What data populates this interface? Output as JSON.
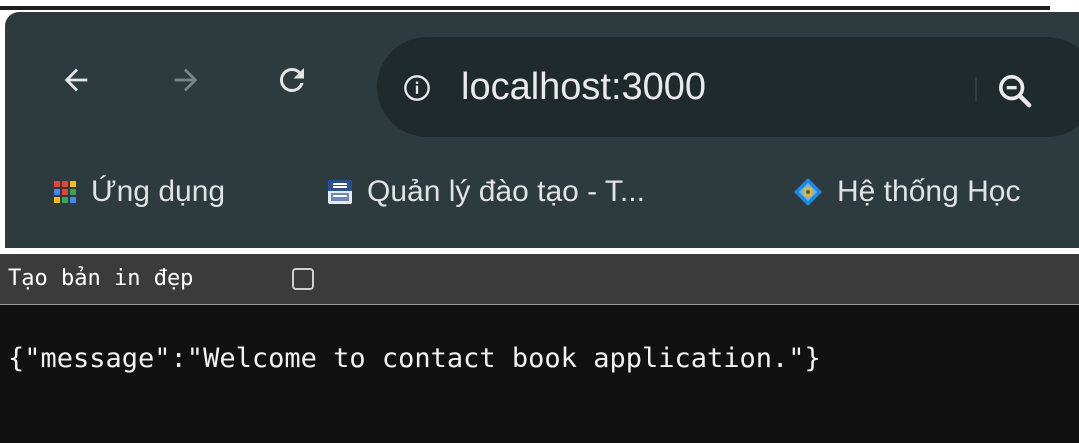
{
  "toolbar": {
    "back_icon": "back-arrow-icon",
    "forward_icon": "forward-arrow-icon",
    "reload_icon": "reload-icon",
    "url": "localhost:3000",
    "site_info_icon": "info-icon",
    "zoom_icon": "zoom-out-icon"
  },
  "bookmarks": [
    {
      "label": "Ứng dụng",
      "icon": "apps-grid-icon"
    },
    {
      "label": "Quản lý đào tạo - T...",
      "icon": "cusc-uiis-favicon"
    },
    {
      "label": "Hệ thống Học",
      "icon": "diamond-favicon"
    }
  ],
  "json_viewer": {
    "pretty_print_label": "Tạo bản in đẹp",
    "pretty_print_checked": false
  },
  "content": {
    "body_text": "{\"message\":\"Welcome to contact book application.\"}"
  },
  "colors": {
    "chrome_bg": "#2d3a3e",
    "omnibox_bg": "#1f2a2d",
    "page_bg": "#111111",
    "pretty_bar_bg": "#3b3b3b"
  }
}
